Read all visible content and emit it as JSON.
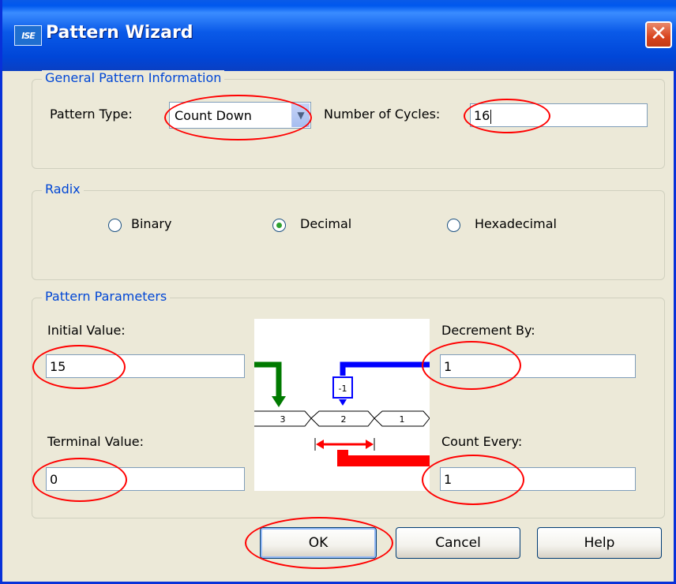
{
  "window": {
    "title": "Pattern Wizard",
    "icon_text": "ISE",
    "close_glyph": "✕"
  },
  "general": {
    "legend": "General Pattern Information",
    "pattern_type_label": "Pattern Type:",
    "pattern_type_value": "Count Down",
    "cycles_label": "Number of Cycles:",
    "cycles_value": "16"
  },
  "radix": {
    "legend": "Radix",
    "options": [
      {
        "label": "Binary",
        "selected": false
      },
      {
        "label": "Decimal",
        "selected": true
      },
      {
        "label": "Hexadecimal",
        "selected": false
      }
    ]
  },
  "params": {
    "legend": "Pattern Parameters",
    "initial_label": "Initial Value:",
    "initial_value": "15",
    "terminal_label": "Terminal Value:",
    "terminal_value": "0",
    "decrement_label": "Decrement By:",
    "decrement_value": "1",
    "count_every_label": "Count Every:",
    "count_every_value": "1"
  },
  "diagram": {
    "decrement_box": "-1",
    "cells": [
      "3",
      "2",
      "1"
    ],
    "colors": {
      "green": "#007a00",
      "blue": "#0000ff",
      "red": "#ff0000"
    }
  },
  "buttons": {
    "ok": "OK",
    "cancel": "Cancel",
    "help": "Help"
  },
  "colors": {
    "legend": "#0046d5",
    "highlight": "#ff0000",
    "titlebar": "#0a5ae8"
  }
}
